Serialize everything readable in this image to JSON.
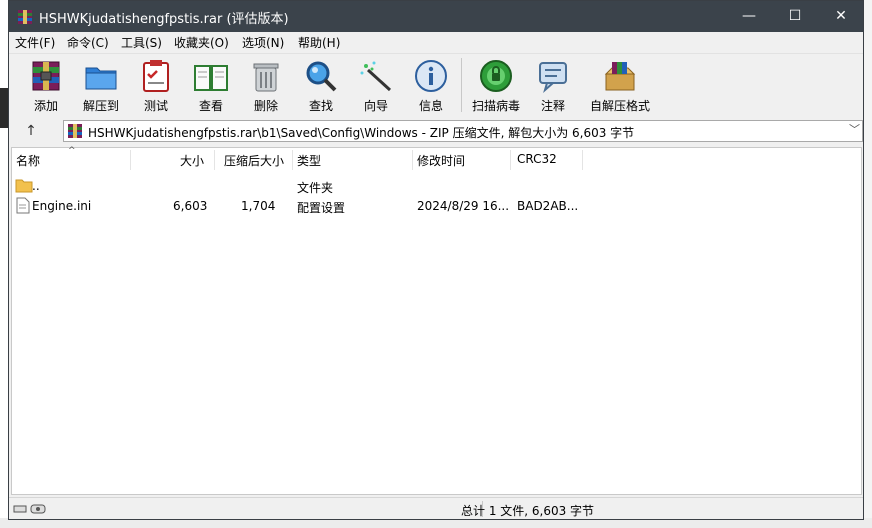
{
  "window": {
    "title": "HSHWKjudatishengfpstis.rar (评估版本)",
    "controls": {
      "minimize": "—",
      "maximize": "☐",
      "close": "✕"
    }
  },
  "menu": {
    "items": [
      {
        "label": "文件(F)"
      },
      {
        "label": "命令(C)"
      },
      {
        "label": "工具(S)"
      },
      {
        "label": "收藏夹(O)"
      },
      {
        "label": "选项(N)"
      },
      {
        "label": "帮助(H)"
      }
    ]
  },
  "toolbar": {
    "items": [
      {
        "label": "添加",
        "icon": "add-archive-icon"
      },
      {
        "label": "解压到",
        "icon": "extract-folder-icon"
      },
      {
        "label": "测试",
        "icon": "test-checklist-icon"
      },
      {
        "label": "查看",
        "icon": "view-book-icon"
      },
      {
        "label": "删除",
        "icon": "delete-bin-icon"
      },
      {
        "label": "查找",
        "icon": "find-magnifier-icon"
      },
      {
        "label": "向导",
        "icon": "wizard-wand-icon"
      },
      {
        "label": "信息",
        "icon": "info-icon"
      },
      {
        "label": "扫描病毒",
        "icon": "virus-scan-icon"
      },
      {
        "label": "注释",
        "icon": "comment-icon"
      },
      {
        "label": "自解压格式",
        "icon": "sfx-box-icon"
      }
    ]
  },
  "address": {
    "up": "↑",
    "path": "HSHWKjudatishengfpstis.rar\\b1\\Saved\\Config\\Windows - ZIP 压缩文件, 解包大小为 6,603 字节",
    "dropdown": "﹀"
  },
  "filelist": {
    "sort_caret": "^",
    "columns": {
      "name": "名称",
      "size": "大小",
      "packed": "压缩后大小",
      "type": "类型",
      "modified": "修改时间",
      "crc": "CRC32"
    },
    "rows": [
      {
        "name": "..",
        "size": "",
        "packed": "",
        "type": "文件夹",
        "modified": "",
        "crc": ""
      },
      {
        "name": "Engine.ini",
        "size": "6,603",
        "packed": "1,704",
        "type": "配置设置",
        "modified": "2024/8/29 16...",
        "crc": "BAD2AB..."
      }
    ]
  },
  "status": {
    "text": "总计 1 文件, 6,603 字节"
  }
}
